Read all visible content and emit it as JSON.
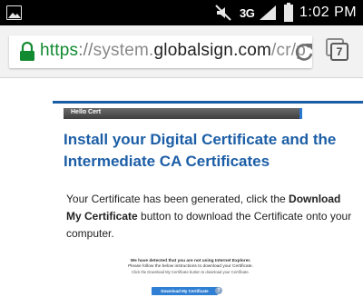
{
  "status_bar": {
    "network": "3G",
    "time": "1:02 PM",
    "icons": [
      "gallery-icon",
      "mute-icon",
      "signal-icon",
      "battery-icon"
    ]
  },
  "url_bar": {
    "scheme": "https",
    "separator": "://",
    "host_prefix": "system.",
    "host_domain": "globalsign.com",
    "path": "/cr/p",
    "tab_count": "7",
    "colors": {
      "scheme": "#128a31",
      "host": "#222222",
      "path": "#8a8a8a"
    }
  },
  "page": {
    "accent": "#1c5ea6",
    "hello_label": "Hello Cert",
    "title": "Install your Digital Certificate and the Intermediate CA Certificates",
    "intro": {
      "part1": "Your Certificate has been generated, click the ",
      "bold": "Download My Certificate",
      "part2": " button to download the Certificate onto your computer."
    },
    "ie_notice": {
      "line1": "We have detected that you are not using Internet Explorer.",
      "line2": "Please follow the below instructions to download your Certificate.",
      "line3": "Click the Download My Certificate button to download your Certificate."
    },
    "download_button_label": "Download My Certificate",
    "help_glyph": "?"
  }
}
